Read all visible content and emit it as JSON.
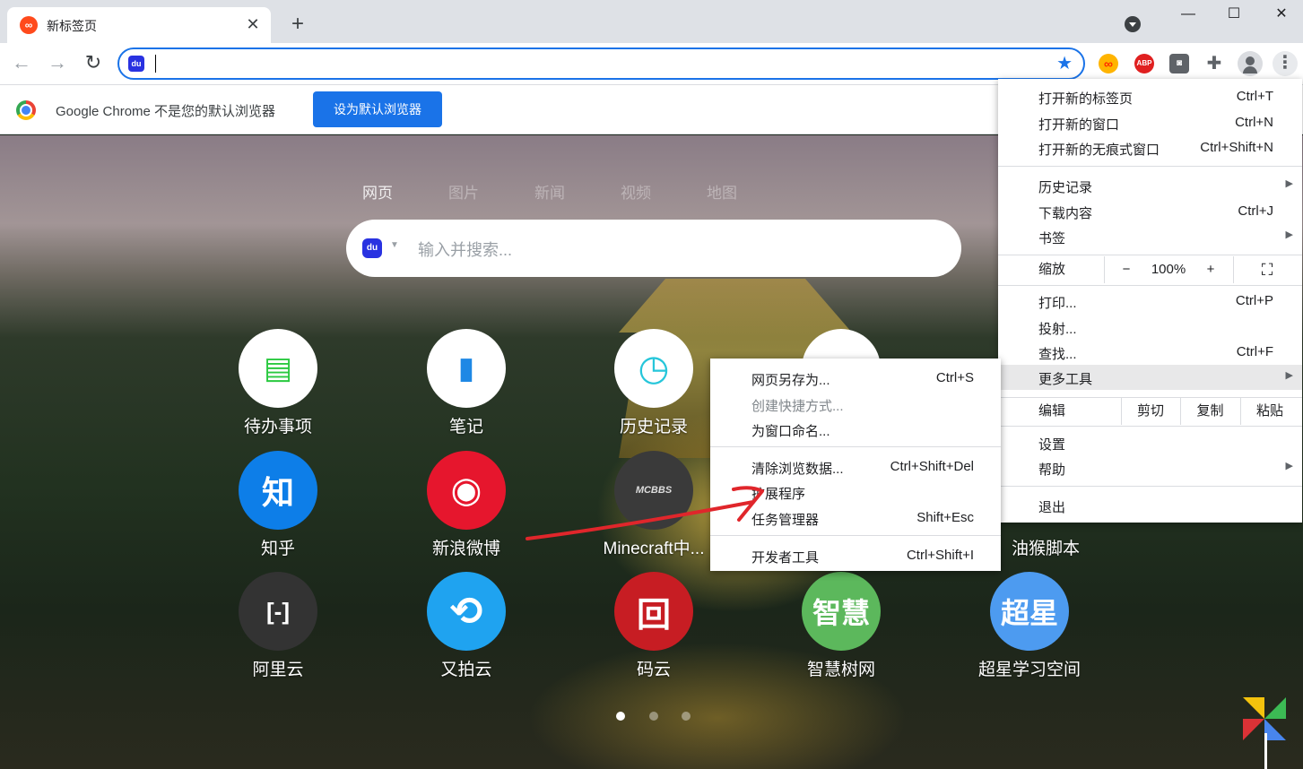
{
  "tab": {
    "title": "新标签页",
    "favicon": "∞",
    "close": "✕"
  },
  "titlebar": {
    "new_tab": "+",
    "minimize": "—",
    "maximize": "☐",
    "close": "✕"
  },
  "toolbar": {
    "back": "←",
    "forward": "→",
    "reload": "↻",
    "omnibox_icon": "du",
    "star": "★",
    "extensions": [
      {
        "name": "infinity-extension",
        "glyph": "∞"
      },
      {
        "name": "adblock-plus-extension",
        "glyph": "ABP"
      },
      {
        "name": "tampermonkey-extension",
        "glyph": "◙"
      },
      {
        "name": "extensions-puzzle",
        "glyph": "✚"
      }
    ],
    "menu": "⋮"
  },
  "infobar": {
    "message": "Google Chrome 不是您的默认浏览器",
    "button": "设为默认浏览器"
  },
  "newtab": {
    "search_tabs": [
      "网页",
      "图片",
      "新闻",
      "视频",
      "地图"
    ],
    "search_icon": "du",
    "search_placeholder": "输入并搜索...",
    "tiles_row1": [
      {
        "label": "待办事项",
        "glyph": "▤",
        "bg": "#ffffff",
        "fg": "#2ac940"
      },
      {
        "label": "笔记",
        "glyph": "▮",
        "bg": "#ffffff",
        "fg": "#1e88e5"
      },
      {
        "label": "历史记录",
        "glyph": "◷",
        "bg": "#ffffff",
        "fg": "#26c6da"
      },
      {
        "label": "",
        "glyph": "▲",
        "bg": "#ffffff",
        "fg": "#f9a825"
      }
    ],
    "tiles_row2": [
      {
        "label": "知乎",
        "glyph": "知",
        "bg": "#0d7ee8",
        "fg": "#ffffff"
      },
      {
        "label": "新浪微博",
        "glyph": "◉",
        "bg": "#e6162d",
        "fg": "#ffffff"
      },
      {
        "label": "Minecraft中...",
        "glyph": "MCBBS",
        "bg": "#3a3a3a",
        "fg": "#dddddd"
      },
      {
        "label": "油猴脚本",
        "glyph": ""
      }
    ],
    "tiles_row3": [
      {
        "label": "阿里云",
        "glyph": "[-]",
        "bg": "#333333",
        "fg": "#ffffff"
      },
      {
        "label": "又拍云",
        "glyph": "⟲",
        "bg": "#1fa3f0",
        "fg": "#ffffff"
      },
      {
        "label": "码云",
        "glyph": "回",
        "bg": "#c71d23",
        "fg": "#ffffff"
      },
      {
        "label": "智慧树网",
        "glyph": "智慧",
        "bg": "#5cb85c",
        "fg": "#ffffff"
      },
      {
        "label": "超星学习空间",
        "glyph": "超星",
        "bg": "#4d9bf0",
        "fg": "#ffffff"
      }
    ],
    "page_dots": 3
  },
  "menu": {
    "new_tab": {
      "label": "打开新的标签页",
      "shortcut": "Ctrl+T"
    },
    "new_window": {
      "label": "打开新的窗口",
      "shortcut": "Ctrl+N"
    },
    "incognito": {
      "label": "打开新的无痕式窗口",
      "shortcut": "Ctrl+Shift+N"
    },
    "history": {
      "label": "历史记录"
    },
    "downloads": {
      "label": "下载内容",
      "shortcut": "Ctrl+J"
    },
    "bookmarks": {
      "label": "书签"
    },
    "zoom": {
      "label": "缩放",
      "minus": "−",
      "value": "100%",
      "plus": "+",
      "fullscreen": "⛶"
    },
    "print": {
      "label": "打印...",
      "shortcut": "Ctrl+P"
    },
    "cast": {
      "label": "投射..."
    },
    "find": {
      "label": "查找...",
      "shortcut": "Ctrl+F"
    },
    "more_tools": {
      "label": "更多工具"
    },
    "edit": {
      "label": "编辑",
      "cut": "剪切",
      "copy": "复制",
      "paste": "粘贴"
    },
    "settings": {
      "label": "设置"
    },
    "help": {
      "label": "帮助"
    },
    "exit": {
      "label": "退出"
    },
    "arrow": "▶"
  },
  "submenu": {
    "save_page": {
      "label": "网页另存为...",
      "shortcut": "Ctrl+S"
    },
    "create_shortcut": {
      "label": "创建快捷方式..."
    },
    "name_window": {
      "label": "为窗口命名..."
    },
    "clear_data": {
      "label": "清除浏览数据...",
      "shortcut": "Ctrl+Shift+Del"
    },
    "extensions": {
      "label": "扩展程序"
    },
    "task_manager": {
      "label": "任务管理器",
      "shortcut": "Shift+Esc"
    },
    "dev_tools": {
      "label": "开发者工具",
      "shortcut": "Ctrl+Shift+I"
    }
  }
}
